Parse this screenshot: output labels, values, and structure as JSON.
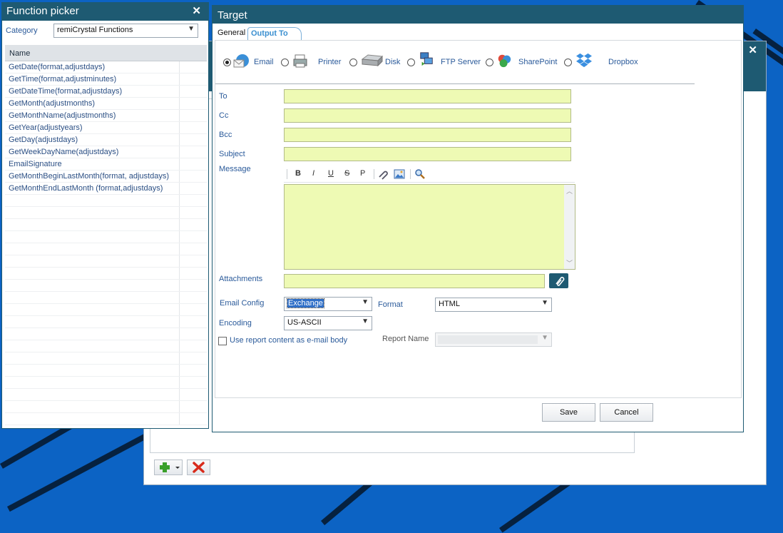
{
  "picker": {
    "title": "Function picker",
    "category_label": "Category",
    "category_value": "remiCrystal Functions",
    "column_header": "Name",
    "functions": [
      "GetDate(format,adjustdays)",
      "GetTime(format,adjustminutes)",
      "GetDateTime(format,adjustdays)",
      "GetMonth(adjustmonths)",
      "GetMonthName(adjustmonths)",
      "GetYear(adjustyears)",
      "GetDay(adjustdays)",
      "GetWeekDayName(adjustdays)",
      "EmailSignature",
      "GetMonthBeginLastMonth(format, adjustdays)",
      "GetMonthEndLastMonth (format,adjustdays)"
    ]
  },
  "target": {
    "title": "Target",
    "tabs": [
      "General",
      "Output To"
    ],
    "active_tab": "Output To",
    "outputs": [
      {
        "label": "Email",
        "icon": "email-icon",
        "selected": true
      },
      {
        "label": "Printer",
        "icon": "printer-icon",
        "selected": false
      },
      {
        "label": "Disk",
        "icon": "disk-icon",
        "selected": false
      },
      {
        "label": "FTP Server",
        "icon": "ftp-server-icon",
        "selected": false
      },
      {
        "label": "SharePoint",
        "icon": "sharepoint-icon",
        "selected": false
      },
      {
        "label": "Dropbox",
        "icon": "dropbox-icon",
        "selected": false
      }
    ],
    "fields": {
      "to_label": "To",
      "cc_label": "Cc",
      "bcc_label": "Bcc",
      "subject_label": "Subject",
      "message_label": "Message",
      "attachments_label": "Attachments",
      "email_config_label": "Email Config",
      "email_config_value": "Exchange",
      "format_label": "Format",
      "format_value": "HTML",
      "encoding_label": "Encoding",
      "encoding_value": "US-ASCII",
      "use_report_label": "Use report content as e-mail body",
      "report_name_label": "Report Name",
      "report_name_value": ""
    },
    "toolbar": {
      "bold": "B",
      "italic": "I",
      "underline": "U",
      "strike": "S",
      "paragraph": "P"
    },
    "buttons": {
      "save": "Save",
      "cancel": "Cancel"
    }
  },
  "colors": {
    "titlebar": "#1e5a72",
    "field_bg": "#eefab4",
    "accent": "#2a5a9a",
    "desktop": "#0c63c4"
  }
}
